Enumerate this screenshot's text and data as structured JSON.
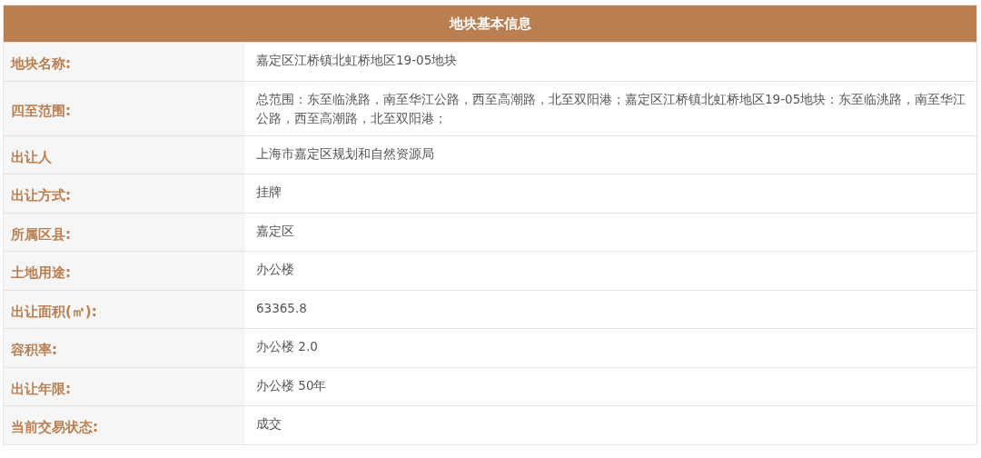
{
  "table": {
    "title": "地块基本信息",
    "rows": [
      {
        "label": "地块名称:",
        "value": "嘉定区江桥镇北虹桥地区19-05地块"
      },
      {
        "label": "四至范围:",
        "value": "总范围：东至临洮路，南至华江公路，西至高潮路，北至双阳港；嘉定区江桥镇北虹桥地区19-05地块：东至临洮路，南至华江公路，西至高潮路，北至双阳港；"
      },
      {
        "label": "出让人",
        "value": "上海市嘉定区规划和自然资源局"
      },
      {
        "label": "出让方式:",
        "value": "挂牌"
      },
      {
        "label": "所属区县:",
        "value": "嘉定区"
      },
      {
        "label": "土地用途:",
        "value": "办公楼"
      },
      {
        "label": "出让面积(㎡):",
        "value": "63365.8"
      },
      {
        "label": "容积率:",
        "value": "办公楼 2.0"
      },
      {
        "label": "出让年限:",
        "value": "办公楼 50年"
      },
      {
        "label": "当前交易状态:",
        "value": "成交"
      }
    ]
  }
}
